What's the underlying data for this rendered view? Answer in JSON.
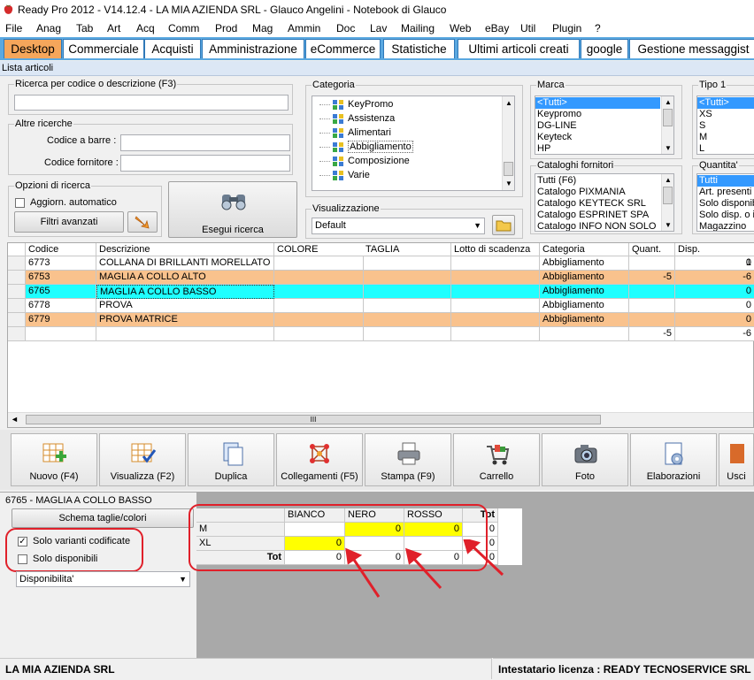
{
  "window": {
    "title": "Ready Pro 2012 - V14.12.4 - LA MIA AZIENDA SRL - Glauco Angelini - Notebook di Glauco"
  },
  "menu": [
    "File",
    "Anag",
    "Tab",
    "Art",
    "Acq",
    "Comm",
    "Prod",
    "Mag",
    "Ammin",
    "Doc",
    "Lav",
    "Mailing",
    "Web",
    "eBay",
    "Util",
    "Plugin",
    "?"
  ],
  "tabs": [
    "Desktop",
    "Commerciale",
    "Acquisti",
    "Amministrazione",
    "eCommerce",
    "Statistiche",
    "Ultimi articoli creati",
    "google",
    "Gestione messaggist"
  ],
  "section_title": "Lista articoli",
  "search": {
    "code_desc_label": "Ricerca per codice o descrizione (F3)",
    "code_desc_value": "",
    "other_label": "Altre ricerche",
    "barcode_label": "Codice a barre :",
    "supplier_code_label": "Codice fornitore :",
    "options_label": "Opzioni di ricerca",
    "auto_update_label": "Aggiorn. automatico",
    "advanced_filters_label": "Filtri avanzati",
    "search_button_label": "Esegui ricerca"
  },
  "categoria": {
    "label": "Categoria",
    "items": [
      "KeyPromo",
      "Assistenza",
      "Alimentari",
      "Abbigliamento",
      "Composizione",
      "Varie"
    ],
    "selected": "Abbigliamento"
  },
  "visualizzazione": {
    "label": "Visualizzazione",
    "value": "Default"
  },
  "marca": {
    "label": "Marca",
    "items": [
      "<Tutti>",
      "Keypromo",
      "DG-LINE",
      "Keyteck",
      "HP"
    ]
  },
  "cataloghi": {
    "label": "Cataloghi fornitori",
    "items": [
      "Tutti (F6)",
      "Catalogo PIXMANIA",
      "Catalogo KEYTECK SRL",
      "Catalogo ESPRINET SPA",
      "Catalogo INFO NON SOLO"
    ]
  },
  "tipo": {
    "label": "Tipo 1",
    "items": [
      "<Tutti>",
      "XS",
      "S",
      "M",
      "L"
    ]
  },
  "quantita": {
    "label": "Quantita'",
    "items": [
      "Tutti",
      "Art. presenti a",
      "Solo disponibi",
      "Solo disp. o in",
      "Magazzino"
    ]
  },
  "grid": {
    "columns": [
      "Codice",
      "Descrizione",
      "COLORE",
      "TAGLIA",
      "Lotto di scadenza",
      "Categoria",
      "Quant.",
      "Disp."
    ],
    "rows": [
      {
        "code": "6773",
        "desc": "COLLANA DI BRILLANTI MORELLATO",
        "colore": "",
        "taglia": "",
        "lotto": "",
        "cat": "Abbigliamento",
        "quant": "",
        "disp": "0",
        "extra": "1"
      },
      {
        "code": "6753",
        "desc": "MAGLIA A COLLO ALTO",
        "colore": "",
        "taglia": "",
        "lotto": "",
        "cat": "Abbigliamento",
        "quant": "-5",
        "disp": "-6",
        "extra": ""
      },
      {
        "code": "6765",
        "desc": "MAGLIA A COLLO BASSO",
        "colore": "",
        "taglia": "",
        "lotto": "",
        "cat": "Abbigliamento",
        "quant": "",
        "disp": "0",
        "extra": ""
      },
      {
        "code": "6778",
        "desc": "PROVA",
        "colore": "",
        "taglia": "",
        "lotto": "",
        "cat": "Abbigliamento",
        "quant": "",
        "disp": "0",
        "extra": ""
      },
      {
        "code": "6779",
        "desc": "PROVA MATRICE",
        "colore": "",
        "taglia": "",
        "lotto": "",
        "cat": "Abbigliamento",
        "quant": "",
        "disp": "0",
        "extra": ""
      }
    ],
    "totals": {
      "quant": "-5",
      "disp": "-6"
    },
    "scroll_grip": "III"
  },
  "toolbar": [
    {
      "label": "Nuovo (F4)",
      "icon": "new-icon"
    },
    {
      "label": "Visualizza (F2)",
      "icon": "view-icon"
    },
    {
      "label": "Duplica",
      "icon": "duplicate-icon"
    },
    {
      "label": "Collegamenti (F5)",
      "icon": "links-icon"
    },
    {
      "label": "Stampa (F9)",
      "icon": "printer-icon"
    },
    {
      "label": "Carrello",
      "icon": "cart-icon"
    },
    {
      "label": "Foto",
      "icon": "camera-icon"
    },
    {
      "label": "Elaborazioni",
      "icon": "process-icon"
    },
    {
      "label": "Usci",
      "icon": "exit-icon"
    }
  ],
  "detail": {
    "title": "6765 - MAGLIA A COLLO BASSO",
    "schema_button": "Schema taglie/colori",
    "solo_varianti_label": "Solo varianti codificate",
    "solo_varianti_checked": true,
    "solo_disponibili_label": "Solo disponibili",
    "solo_disponibili_checked": false,
    "dropdown_value": "Disponibilita'",
    "matrix": {
      "columns": [
        "BIANCO",
        "NERO",
        "ROSSO",
        "Tot"
      ],
      "rows": [
        {
          "label": "M",
          "values": [
            "",
            "0",
            "0"
          ],
          "tot": "0"
        },
        {
          "label": "XL",
          "values": [
            "0",
            "",
            ""
          ],
          "tot": "0"
        }
      ],
      "tot_label": "Tot",
      "col_totals": [
        "0",
        "0",
        "0"
      ],
      "grand_total": "0"
    }
  },
  "status": {
    "left": "LA MIA AZIENDA SRL",
    "right": "Intestatario licenza : READY TECNOSERVICE SRL"
  },
  "colors": {
    "tab_bar": "#5aa8e0",
    "active_tab": "#f5a65b",
    "row_orange": "#f9c28d",
    "row_cyan": "#1fffff",
    "highlight_yellow": "#ffff00",
    "annotation_red": "#e0202a"
  }
}
